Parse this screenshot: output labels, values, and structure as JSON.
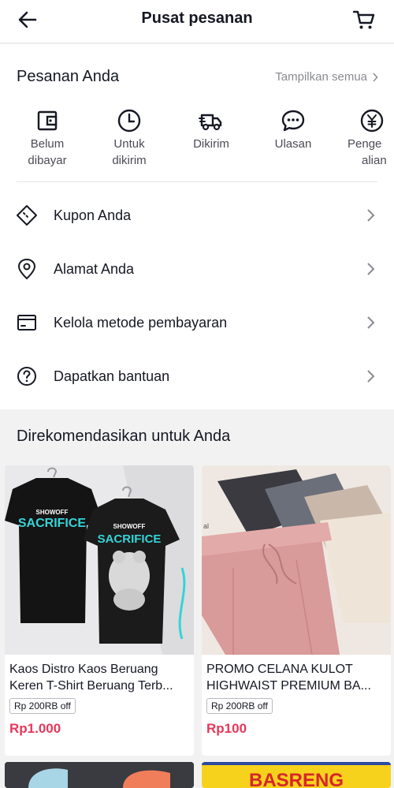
{
  "header": {
    "title": "Pusat pesanan",
    "back_icon": "arrow-left-icon",
    "cart_icon": "cart-icon"
  },
  "orders": {
    "title": "Pesanan Anda",
    "show_all": "Tampilkan semua",
    "statuses": [
      {
        "line1": "Belum",
        "line2": "dibayar",
        "icon": "wallet-icon"
      },
      {
        "line1": "Untuk",
        "line2": "dikirim",
        "icon": "clock-icon"
      },
      {
        "line1": "Dikirim",
        "line2": "",
        "icon": "truck-icon"
      },
      {
        "line1": "Ulasan",
        "line2": "",
        "icon": "chat-icon"
      },
      {
        "line1": "Penge",
        "line2": "alian",
        "icon": "refund-icon"
      }
    ]
  },
  "menu": [
    {
      "label": "Kupon Anda",
      "icon": "coupon-icon"
    },
    {
      "label": "Alamat Anda",
      "icon": "location-pin-icon"
    },
    {
      "label": "Kelola metode pembayaran",
      "icon": "card-icon"
    },
    {
      "label": "Dapatkan bantuan",
      "icon": "help-icon"
    }
  ],
  "recommend": {
    "title": "Direkomendasikan untuk Anda",
    "products": [
      {
        "name_line1": "Kaos Distro Kaos Beruang",
        "name_line2": "Keren T-Shirt Beruang Terb...",
        "badge": "Rp 200RB off",
        "price": "Rp1.000",
        "image_text": "SACRIFICE",
        "image_subtext": "SHOWOFF"
      },
      {
        "name_line1": "PROMO CELANA KULOT",
        "name_line2": "HIGHWAIST PREMIUM BA...",
        "badge": "Rp 200RB off",
        "price": "Rp100"
      },
      {
        "image_text": "BASRENG"
      }
    ]
  },
  "colors": {
    "price": "#e6375a",
    "accent_teal": "#35d3d8",
    "banner_yellow": "#f7d21c",
    "banner_red": "#d7262b"
  }
}
